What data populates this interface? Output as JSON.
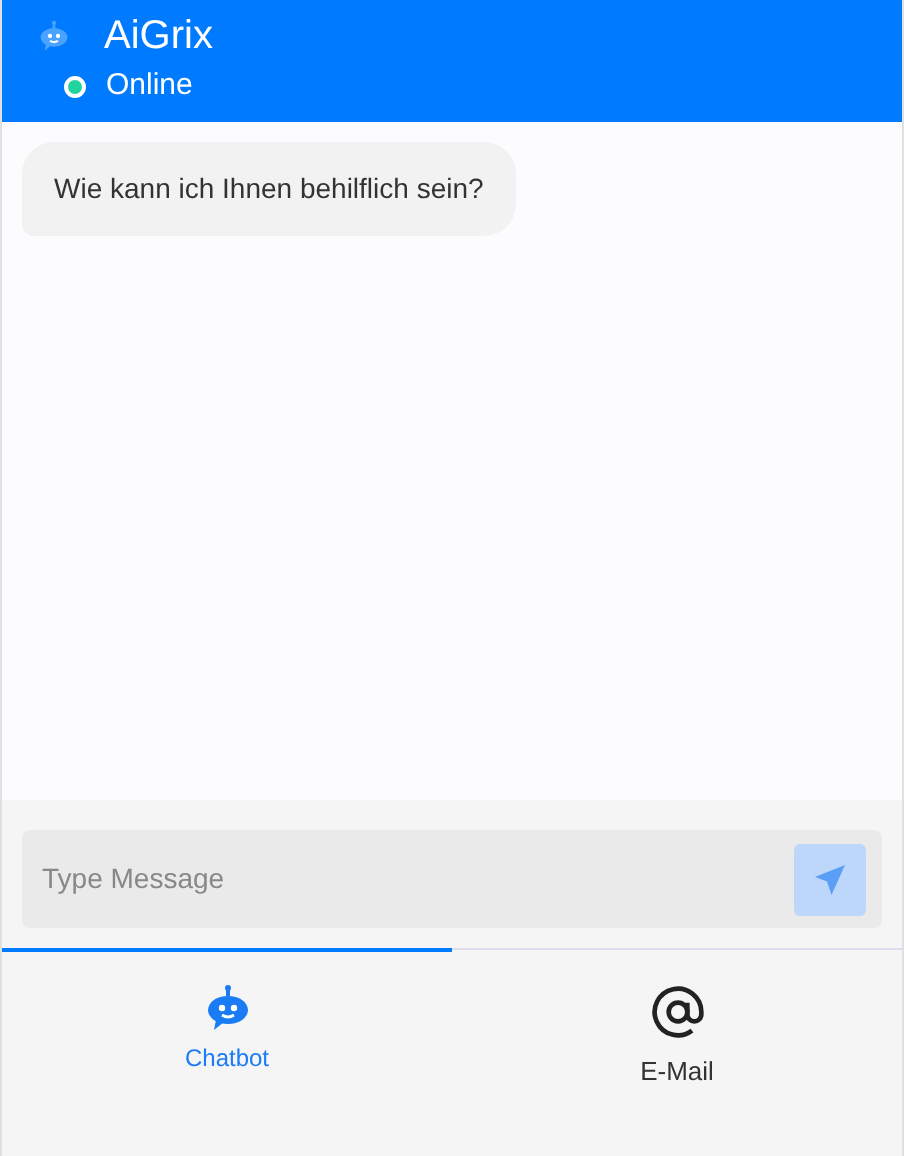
{
  "header": {
    "title": "AiGrix",
    "status": "Online",
    "online": true
  },
  "messages": [
    {
      "text": "Wie kann ich Ihnen behilflich sein?"
    }
  ],
  "composer": {
    "placeholder": "Type Message"
  },
  "tabs": [
    {
      "label": "Chatbot",
      "kind": "bot",
      "selected": true
    },
    {
      "label": "E-Mail",
      "kind": "at",
      "selected": false
    }
  ]
}
